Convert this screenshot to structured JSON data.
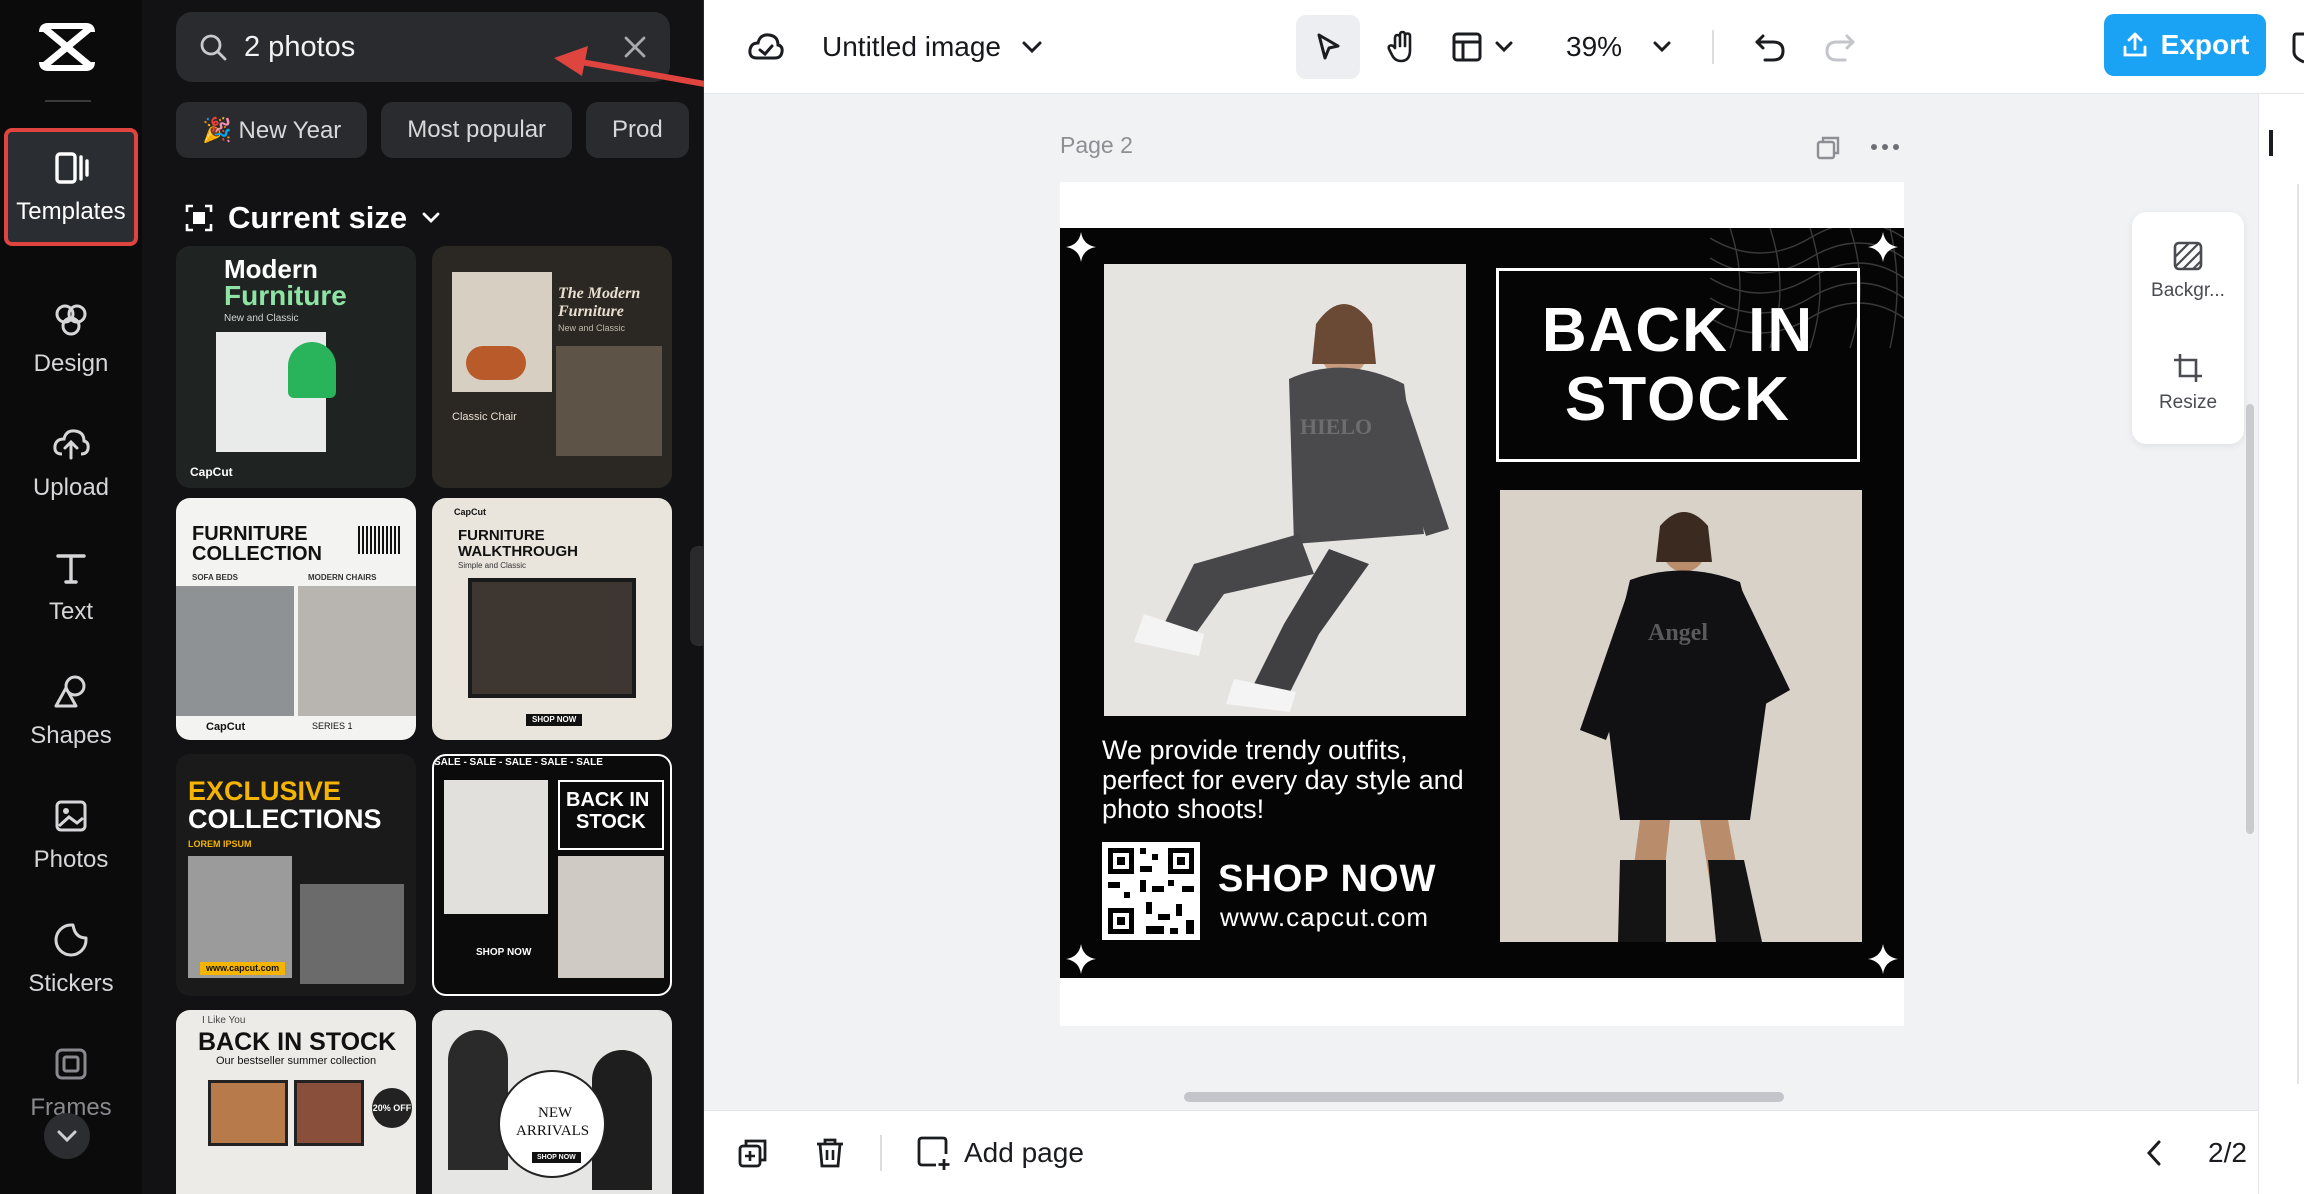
{
  "rail": {
    "items": [
      {
        "label": "Templates",
        "icon": "templates-icon"
      },
      {
        "label": "Design",
        "icon": "design-icon"
      },
      {
        "label": "Upload",
        "icon": "upload-icon"
      },
      {
        "label": "Text",
        "icon": "text-icon"
      },
      {
        "label": "Shapes",
        "icon": "shapes-icon"
      },
      {
        "label": "Photos",
        "icon": "photos-icon"
      },
      {
        "label": "Stickers",
        "icon": "stickers-icon"
      },
      {
        "label": "Frames",
        "icon": "frames-icon"
      }
    ],
    "active": "Templates"
  },
  "panel": {
    "search_value": "2 photos",
    "chips": [
      "🎉 New Year",
      "Most popular",
      "Prod"
    ],
    "size_label": "Current size"
  },
  "templates": [
    {
      "line1": "Modern",
      "line2": "Furniture",
      "sub": "New and Classic",
      "brand": "CapCut"
    },
    {
      "line1": "The Modern",
      "line2": "Furniture",
      "sub": "New and Classic",
      "extra": "Classic Chair"
    },
    {
      "line1": "FURNITURE",
      "line2": "COLLECTION",
      "left": "SOFA BEDS",
      "right": "MODERN CHAIRS",
      "brand": "CapCut",
      "series": "SERIES 1"
    },
    {
      "line1": "FURNITURE",
      "line2": "WALKTHROUGH",
      "sub": "Simple and Classic",
      "cta": "SHOP NOW",
      "brand": "CapCut"
    },
    {
      "line1": "EXCLUSIVE",
      "line2": "COLLECTIONS",
      "sub": "LOREM IPSUM",
      "url": "www.capcut.com"
    },
    {
      "line1": "BACK IN",
      "line2": "STOCK",
      "banner": "SALE - SALE - SALE - SALE - SALE",
      "cta": "SHOP NOW"
    },
    {
      "line1": "BACK IN STOCK",
      "sub": "Our bestseller summer collection",
      "badge": "20% OFF",
      "tag": "I Like You"
    },
    {
      "line1": "NEW",
      "line2": "ARRIVALS",
      "cta": "SHOP NOW"
    }
  ],
  "toolbar": {
    "title": "Untitled image",
    "zoom": "39%",
    "export_label": "Export"
  },
  "canvas": {
    "page_label": "Page 2",
    "poster": {
      "headline_1": "BACK IN",
      "headline_2": "STOCK",
      "blurb": "We provide trendy outfits, perfect for every day style and photo shoots!",
      "cta": "SHOP NOW",
      "url": "www.capcut.com",
      "hoodie_1": "HIELO",
      "hoodie_2": "Angel"
    }
  },
  "side_tools": [
    {
      "label": "Backgr...",
      "icon": "background-icon"
    },
    {
      "label": "Resize",
      "icon": "resize-icon"
    }
  ],
  "bottom": {
    "add_page": "Add page",
    "pager": "2/2"
  },
  "colors": {
    "accent": "#1aa3f5",
    "highlight": "#e0443e",
    "panel_bg": "#121214",
    "rail_bg": "#0b0b0c"
  }
}
